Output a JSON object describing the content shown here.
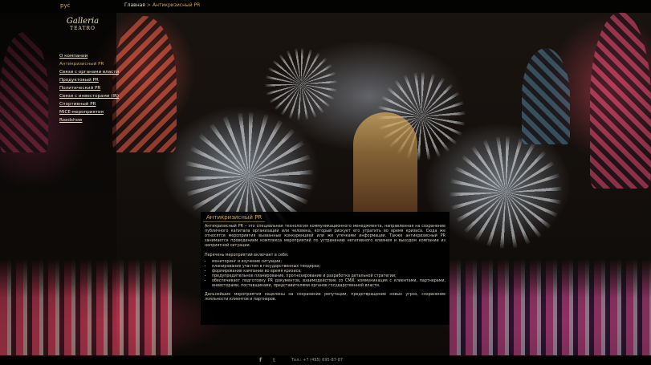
{
  "topbar": {
    "language": "рус",
    "breadcrumb_home": "Главная",
    "breadcrumb_separator": ">",
    "breadcrumb_current": "Антикризисный PR"
  },
  "logo": {
    "line1": "Galleria",
    "line2": "TEATRO"
  },
  "menu": {
    "items": [
      {
        "label": "О компании",
        "active": false
      },
      {
        "label": "Антикризисный PR",
        "active": true
      },
      {
        "label": "Связи с органами власти",
        "active": false
      },
      {
        "label": "Продуктовый PR",
        "active": false
      },
      {
        "label": "Политический PR",
        "active": false
      },
      {
        "label": "Связи с инвесторами (IR)",
        "active": false
      },
      {
        "label": "Спортивный PR",
        "active": false
      },
      {
        "label": "MICE-мероприятия",
        "active": false
      },
      {
        "label": "Roadshow",
        "active": false
      }
    ]
  },
  "panel": {
    "title": "Антикризисный PR",
    "intro": "Антикризисный PR – это специальная технология коммуникационного менеджмента, направленная на сохранение публичного капитала организации или человека, который рискует его утратить во время кризиса. Сюда же относятся мероприятия вызванные конкуренцией или же утечками информации. Также антикризисный PR занимается проведением комплекса мероприятий по устранению негативного влияния и выходом компании из неприятной ситуации.",
    "list_heading": "Перечень мероприятий включает в себя:",
    "list": [
      "мониторинг и изучение ситуации;",
      "планирование участия в государственных тендерах;",
      "формирование кампании во время кризиса;",
      "предупредительное планирование, прогнозирование и разработка детальной стратегии;",
      "обеспечивает подготовку PR документов, взаимодействие со СМИ, коммуникация с клиентами, партнерами, инвесторами, поставщиками, представителями органов государственной власти."
    ],
    "closing": "Дальнейшие мероприятия нацелены на сохранение репутации, предотвращение новых угроз, сохранение лояльности клиентов и партнеров."
  },
  "footer": {
    "facebook_icon": "f",
    "twitter_icon": "t",
    "phone": "Тел.: +7 (495) 695-87-87"
  },
  "colors": {
    "accent": "#c9a35c",
    "panel_bg": "#000000"
  }
}
